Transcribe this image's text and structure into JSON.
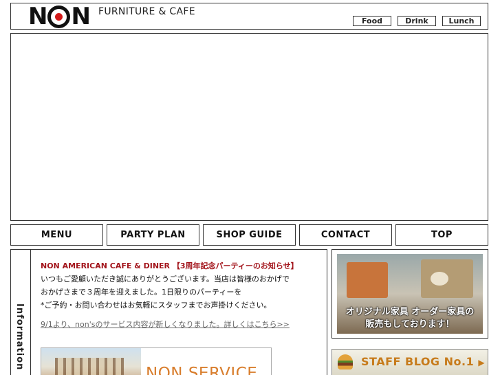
{
  "header": {
    "logo_left": "N",
    "logo_right": "N",
    "tagline": "FURNITURE & CAFE",
    "links": [
      "Food",
      "Drink",
      "Lunch"
    ]
  },
  "nav": {
    "items": [
      "MENU",
      "PARTY PLAN",
      "SHOP GUIDE",
      "CONTACT",
      "TOP"
    ]
  },
  "info": {
    "sidebar_label": "Information",
    "headline": "NON AMERICAN CAFE & DINER 【3周年記念パーティーのお知らせ】",
    "lines": [
      "いつもご愛顧いただき誠にありがとうございます。当店は皆様のおかげで",
      "おかげさまで３周年を迎えました。1日限りのパーティーを",
      "*ご予約・お問い合わせはお気軽にスタッフまでお声掛けください。"
    ],
    "news_link": "9/1より、non'sのサービス内容が新しくなりました。詳しくはこちら>>",
    "service_banner_text": "NON SERVICE"
  },
  "furniture_ad": {
    "caption_line1": "オリジナル家具 オーダー家具の",
    "caption_line2": "販売もしております！"
  },
  "blog_banner": {
    "label": "STAFF  BLOG No.1",
    "arrow": "▶"
  },
  "colors": {
    "accent_red": "#d21a1a",
    "headline_red": "#a3151c",
    "blog_orange": "#c77b1b",
    "service_orange": "#d87d2c"
  }
}
